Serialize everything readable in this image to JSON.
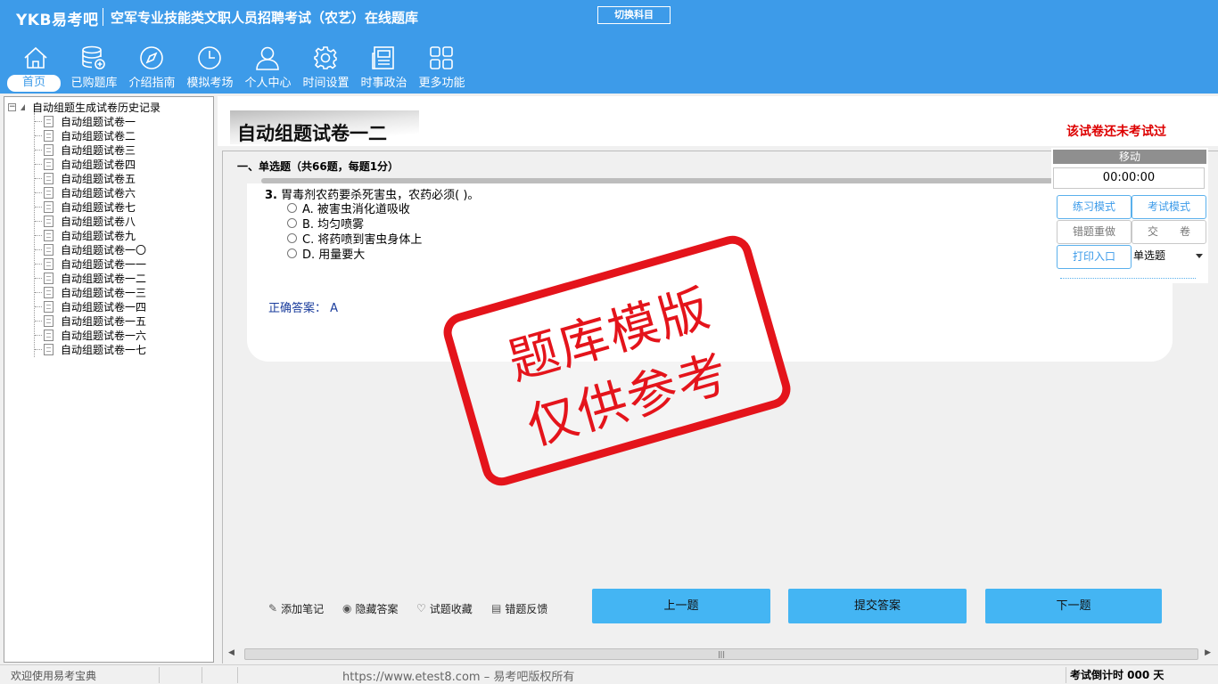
{
  "header": {
    "brand": "YKB易考吧",
    "title": "空军专业技能类文职人员招聘考试（农艺）在线题库",
    "switch_label": "切换科目",
    "nav": [
      {
        "label": "首页",
        "icon": "home-icon",
        "active": true
      },
      {
        "label": "已购题库",
        "icon": "database-icon",
        "active": false
      },
      {
        "label": "介绍指南",
        "icon": "compass-icon",
        "active": false
      },
      {
        "label": "模拟考场",
        "icon": "clock-icon",
        "active": false
      },
      {
        "label": "个人中心",
        "icon": "user-icon",
        "active": false
      },
      {
        "label": "时间设置",
        "icon": "gear-icon",
        "active": false
      },
      {
        "label": "时事政治",
        "icon": "news-icon",
        "active": false
      },
      {
        "label": "更多功能",
        "icon": "grid-icon",
        "active": false
      }
    ]
  },
  "tree": {
    "root_label": "自动组题生成试卷历史记录",
    "items": [
      "自动组题试卷一",
      "自动组题试卷二",
      "自动组题试卷三",
      "自动组题试卷四",
      "自动组题试卷五",
      "自动组题试卷六",
      "自动组题试卷七",
      "自动组题试卷八",
      "自动组题试卷九",
      "自动组题试卷一〇",
      "自动组题试卷一一",
      "自动组题试卷一二",
      "自动组题试卷一三",
      "自动组题试卷一四",
      "自动组题试卷一五",
      "自动组题试卷一六",
      "自动组题试卷一七"
    ]
  },
  "paper": {
    "title": "自动组题试卷一二",
    "status": "该试卷还未考试过",
    "section": "一、单选题（共66题，每题1分）"
  },
  "question": {
    "number": "3.",
    "text": "胃毒剂农药要杀死害虫，农药必须( )。",
    "options": [
      "A. 被害虫消化道吸收",
      "B. 均匀喷雾",
      "C. 将药喷到害虫身体上",
      "D. 用量要大"
    ],
    "answer_label": "正确答案：",
    "answer_value": "A"
  },
  "stamp": {
    "line1": "题库模版",
    "line2": "仅供参考"
  },
  "tools": {
    "note": "添加笔记",
    "hide_answer": "隐藏答案",
    "favorite": "试题收藏",
    "feedback": "错题反馈"
  },
  "buttons": {
    "prev": "上一题",
    "submit_answer": "提交答案",
    "next": "下一题"
  },
  "control": {
    "move": "移动",
    "timer": "00:00:00",
    "practice": "练习模式",
    "exam": "考试模式",
    "redo": "错题重做",
    "hand_in": "交　　卷",
    "print": "打印入口",
    "type_selected": "单选题"
  },
  "statusbar": {
    "left": "欢迎使用易考宝典",
    "center": "https://www.etest8.com – 易考吧版权所有",
    "right": "考试倒计时 000 天"
  }
}
